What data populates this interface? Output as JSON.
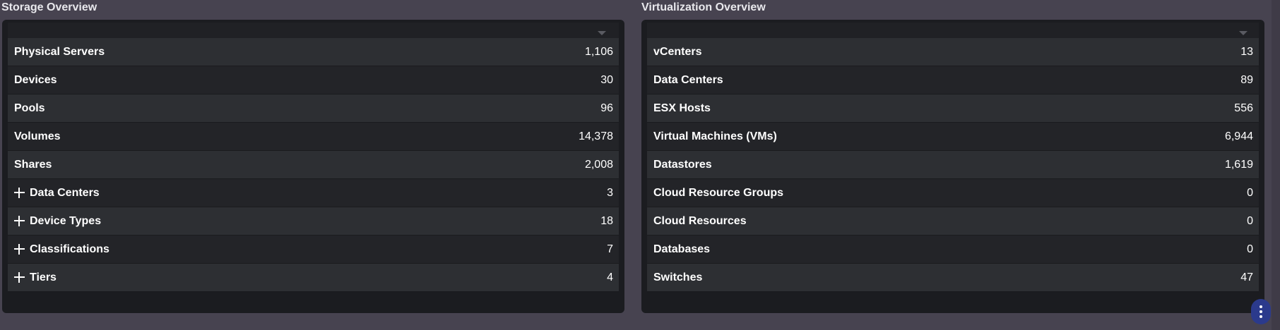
{
  "storage": {
    "title": "Storage Overview",
    "rows": [
      {
        "label": "Physical Servers",
        "value": "1,106",
        "expandable": false
      },
      {
        "label": "Devices",
        "value": "30",
        "expandable": false
      },
      {
        "label": "Pools",
        "value": "96",
        "expandable": false
      },
      {
        "label": "Volumes",
        "value": "14,378",
        "expandable": false
      },
      {
        "label": "Shares",
        "value": "2,008",
        "expandable": false
      },
      {
        "label": "Data Centers",
        "value": "3",
        "expandable": true
      },
      {
        "label": "Device Types",
        "value": "18",
        "expandable": true
      },
      {
        "label": "Classifications",
        "value": "7",
        "expandable": true
      },
      {
        "label": "Tiers",
        "value": "4",
        "expandable": true
      }
    ]
  },
  "virtualization": {
    "title": "Virtualization Overview",
    "rows": [
      {
        "label": "vCenters",
        "value": "13",
        "expandable": false
      },
      {
        "label": "Data Centers",
        "value": "89",
        "expandable": false
      },
      {
        "label": "ESX Hosts",
        "value": "556",
        "expandable": false
      },
      {
        "label": "Virtual Machines (VMs)",
        "value": "6,944",
        "expandable": false
      },
      {
        "label": "Datastores",
        "value": "1,619",
        "expandable": false
      },
      {
        "label": "Cloud Resource Groups",
        "value": "0",
        "expandable": false
      },
      {
        "label": "Cloud Resources",
        "value": "0",
        "expandable": false
      },
      {
        "label": "Databases",
        "value": "0",
        "expandable": false
      },
      {
        "label": "Switches",
        "value": "47",
        "expandable": false
      }
    ]
  },
  "icons": {
    "sort": "chevron-down-icon",
    "expand": "plus-icon",
    "more": "more-vertical-icon"
  }
}
